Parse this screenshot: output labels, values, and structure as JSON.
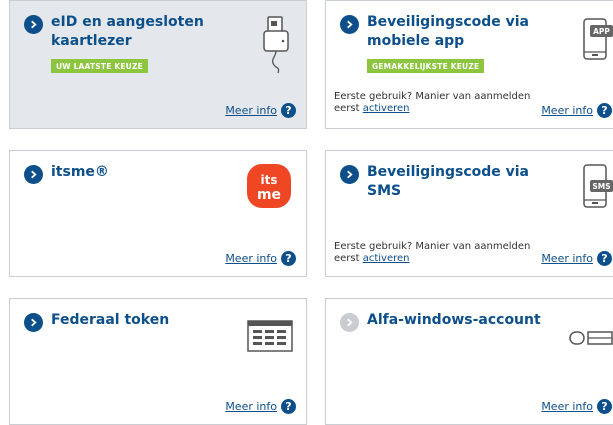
{
  "cards": {
    "eid": {
      "title": "eID en aangesloten kaartlezer",
      "badge": "UW LAATSTE KEUZE",
      "more_info": "Meer info",
      "help": "?",
      "icon": "card-reader-icon"
    },
    "mobile": {
      "title": "Beveiligingscode via mobiele app",
      "badge": "GEMAKKELIJKSTE KEUZE",
      "note_prefix": "Eerste gebruik? Manier van aanmelden eerst ",
      "note_link": "activeren",
      "more_info": "Meer info",
      "help": "?",
      "icon": "phone-app-icon",
      "icon_label": "APP"
    },
    "itsme": {
      "title": "itsme®",
      "more_info": "Meer info",
      "help": "?",
      "icon": "itsme-logo",
      "logo_text": "itsme"
    },
    "sms": {
      "title": "Beveiligingscode via SMS",
      "note_prefix": "Eerste gebruik? Manier van aanmelden eerst ",
      "note_link": "activeren",
      "more_info": "Meer info",
      "help": "?",
      "icon": "phone-sms-icon",
      "icon_label": "SMS"
    },
    "token": {
      "title": "Federaal token",
      "more_info": "Meer info",
      "help": "?",
      "icon": "token-grid-icon"
    },
    "windows": {
      "title": "Alfa-windows-account",
      "more_info": "Meer info",
      "help": "?",
      "icon": "windows-account-icon"
    }
  },
  "colors": {
    "brand_blue": "#0d4f8b",
    "badge_green": "#8cc63f",
    "selected_bg": "#e4e8ed",
    "itsme_red": "#ef4623"
  }
}
